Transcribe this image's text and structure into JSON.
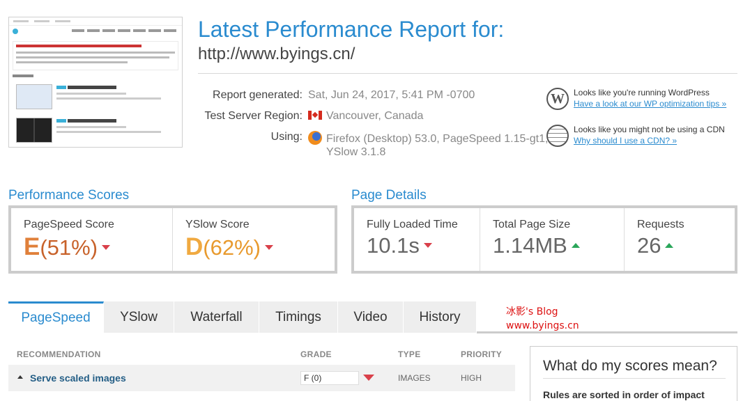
{
  "header": {
    "title": "Latest Performance Report for:",
    "url": "http://www.byings.cn/"
  },
  "info": {
    "report_generated_label": "Report generated:",
    "report_generated_value": "Sat, Jun 24, 2017, 5:41 PM -0700",
    "server_region_label": "Test Server Region:",
    "server_region_value": "Vancouver, Canada",
    "using_label": "Using:",
    "using_value_line1": "Firefox (Desktop) 53.0, PageSpeed 1.15-gt1,",
    "using_value_line2": "YSlow 3.1.8"
  },
  "notes": {
    "wordpress_text": "Looks like you're running WordPress",
    "wordpress_link": "Have a look at our WP optimization tips »",
    "cdn_text": "Looks like you might not be using a CDN",
    "cdn_link": "Why should I use a CDN? »"
  },
  "performance": {
    "title": "Performance Scores",
    "pagespeed_label": "PageSpeed Score",
    "pagespeed_grade": "E",
    "pagespeed_pct": "(51%)",
    "pagespeed_color": "#e0803a",
    "yslow_label": "YSlow Score",
    "yslow_grade": "D",
    "yslow_pct": "(62%)",
    "yslow_color": "#f0a940"
  },
  "details": {
    "title": "Page Details",
    "loaded_label": "Fully Loaded Time",
    "loaded_value": "10.1s",
    "size_label": "Total Page Size",
    "size_value": "1.14MB",
    "requests_label": "Requests",
    "requests_value": "26"
  },
  "tabs": [
    {
      "label": "PageSpeed"
    },
    {
      "label": "YSlow"
    },
    {
      "label": "Waterfall"
    },
    {
      "label": "Timings"
    },
    {
      "label": "Video"
    },
    {
      "label": "History"
    }
  ],
  "watermark": {
    "line1": "冰影's Blog",
    "line2": "www.byings.cn"
  },
  "table": {
    "col_recommendation": "RECOMMENDATION",
    "col_grade": "GRADE",
    "col_type": "TYPE",
    "col_priority": "PRIORITY",
    "rows": [
      {
        "name": "Serve scaled images",
        "grade": "F (0)",
        "type": "IMAGES",
        "priority": "HIGH"
      }
    ]
  },
  "scores_help": {
    "title": "What do my scores mean?",
    "text": "Rules are sorted in order of impact"
  },
  "colors": {
    "accent": "#2a8bcf",
    "down_arrow": "#d9404a",
    "up_arrow": "#2aa65a"
  }
}
